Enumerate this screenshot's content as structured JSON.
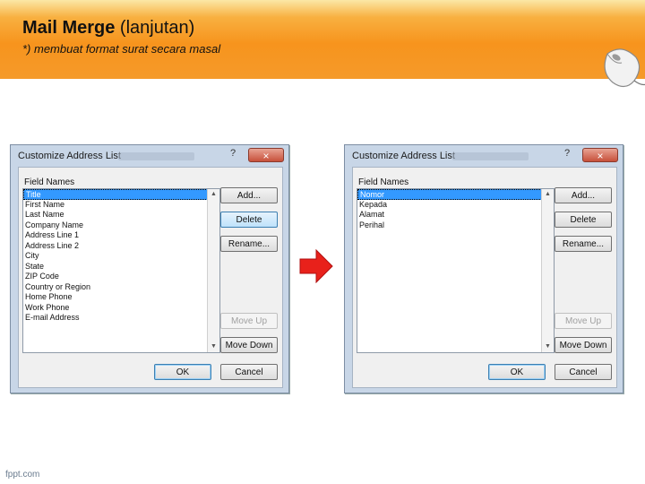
{
  "header": {
    "title_bold": "Mail Merge",
    "title_rest": "(lanjutan)",
    "subtitle": "*) membuat format surat secara masal"
  },
  "dialog_left": {
    "title": "Customize Address List",
    "help": "?",
    "close": "×",
    "field_names_label": "Field Names",
    "fields": [
      "Title",
      "First Name",
      "Last Name",
      "Company Name",
      "Address Line 1",
      "Address Line 2",
      "City",
      "State",
      "ZIP Code",
      "Country or Region",
      "Home Phone",
      "Work Phone",
      "E-mail Address"
    ],
    "selected_index": 0,
    "buttons": {
      "add": "Add...",
      "delete": "Delete",
      "rename": "Rename...",
      "move_up": "Move Up",
      "move_down": "Move Down",
      "ok": "OK",
      "cancel": "Cancel"
    }
  },
  "dialog_right": {
    "title": "Customize Address List",
    "help": "?",
    "close": "×",
    "field_names_label": "Field Names",
    "fields": [
      "Nomor",
      "Kepada",
      "Alamat",
      "Perihal"
    ],
    "selected_index": 0,
    "buttons": {
      "add": "Add...",
      "delete": "Delete",
      "rename": "Rename...",
      "move_up": "Move Up",
      "move_down": "Move Down",
      "ok": "OK",
      "cancel": "Cancel"
    }
  },
  "footer": {
    "text": "fppt.com"
  },
  "colors": {
    "accent": "#f7941d",
    "arrow": "#e8211b",
    "selection": "#3399ff"
  }
}
